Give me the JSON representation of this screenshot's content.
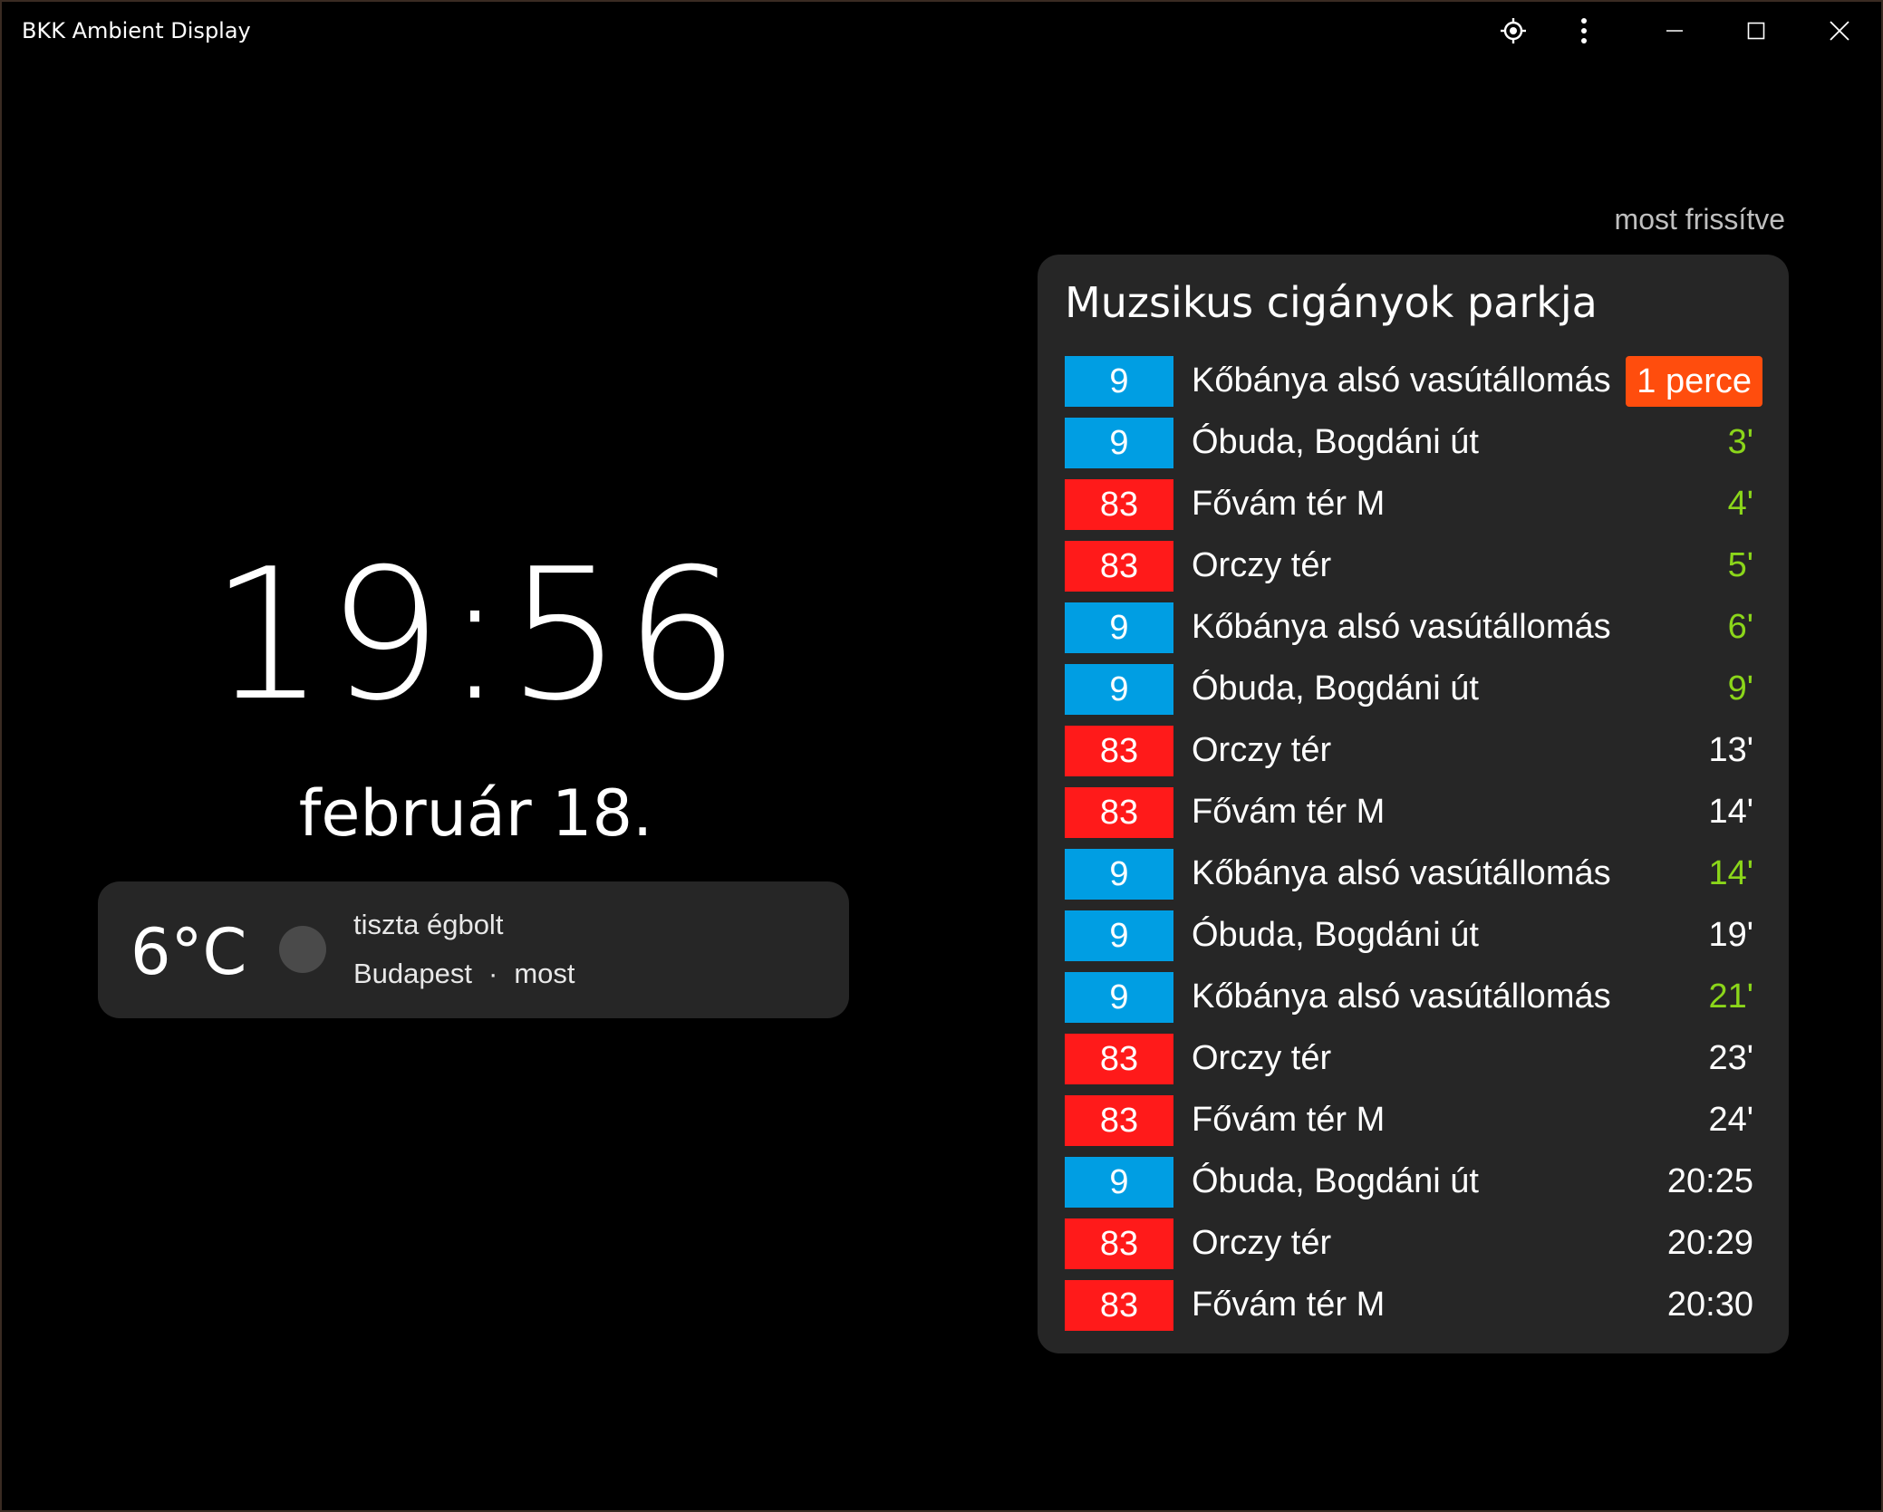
{
  "window": {
    "title": "BKK Ambient Display"
  },
  "icons": {
    "locate": "crosshair-target-icon",
    "more": "vertical-ellipsis-icon",
    "minimize": "minimize-icon",
    "maximize": "maximize-icon",
    "close": "close-icon",
    "weather": "clear-sky-icon"
  },
  "refresh_status": "most frissítve",
  "clock": {
    "time": "19:56",
    "date": "február 18."
  },
  "weather": {
    "temperature": "6°C",
    "description": "tiszta égbolt",
    "city": "Budapest",
    "separator": "·",
    "updated": "most"
  },
  "stop": {
    "name": "Muzsikus cigányok parkja",
    "departures": [
      {
        "route": "9",
        "route_color": "#009ee3",
        "destination": "Kőbánya alsó vasútállomás",
        "time": "1 perce",
        "style": "now"
      },
      {
        "route": "9",
        "route_color": "#009ee3",
        "destination": "Óbuda, Bogdáni út",
        "time": "3'",
        "style": "green"
      },
      {
        "route": "83",
        "route_color": "#ff1a1a",
        "destination": "Fővám tér M",
        "time": "4'",
        "style": "green"
      },
      {
        "route": "83",
        "route_color": "#ff1a1a",
        "destination": "Orczy tér",
        "time": "5'",
        "style": "green"
      },
      {
        "route": "9",
        "route_color": "#009ee3",
        "destination": "Kőbánya alsó vasútállomás",
        "time": "6'",
        "style": "green"
      },
      {
        "route": "9",
        "route_color": "#009ee3",
        "destination": "Óbuda, Bogdáni út",
        "time": "9'",
        "style": "green"
      },
      {
        "route": "83",
        "route_color": "#ff1a1a",
        "destination": "Orczy tér",
        "time": "13'",
        "style": "white"
      },
      {
        "route": "83",
        "route_color": "#ff1a1a",
        "destination": "Fővám tér M",
        "time": "14'",
        "style": "white"
      },
      {
        "route": "9",
        "route_color": "#009ee3",
        "destination": "Kőbánya alsó vasútállomás",
        "time": "14'",
        "style": "green"
      },
      {
        "route": "9",
        "route_color": "#009ee3",
        "destination": "Óbuda, Bogdáni út",
        "time": "19'",
        "style": "white"
      },
      {
        "route": "9",
        "route_color": "#009ee3",
        "destination": "Kőbánya alsó vasútállomás",
        "time": "21'",
        "style": "green"
      },
      {
        "route": "83",
        "route_color": "#ff1a1a",
        "destination": "Orczy tér",
        "time": "23'",
        "style": "white"
      },
      {
        "route": "83",
        "route_color": "#ff1a1a",
        "destination": "Fővám tér M",
        "time": "24'",
        "style": "white"
      },
      {
        "route": "9",
        "route_color": "#009ee3",
        "destination": "Óbuda, Bogdáni út",
        "time": "20:25",
        "style": "white"
      },
      {
        "route": "83",
        "route_color": "#ff1a1a",
        "destination": "Orczy tér",
        "time": "20:29",
        "style": "white"
      },
      {
        "route": "83",
        "route_color": "#ff1a1a",
        "destination": "Fővám tér M",
        "time": "20:30",
        "style": "white"
      }
    ]
  },
  "colors": {
    "background": "#000000",
    "card": "#262626",
    "route_tram": "#009ee3",
    "route_bus": "#ff1a1a",
    "time_soon": "#8bd61a",
    "time_now_badge": "#ff4d0d"
  }
}
